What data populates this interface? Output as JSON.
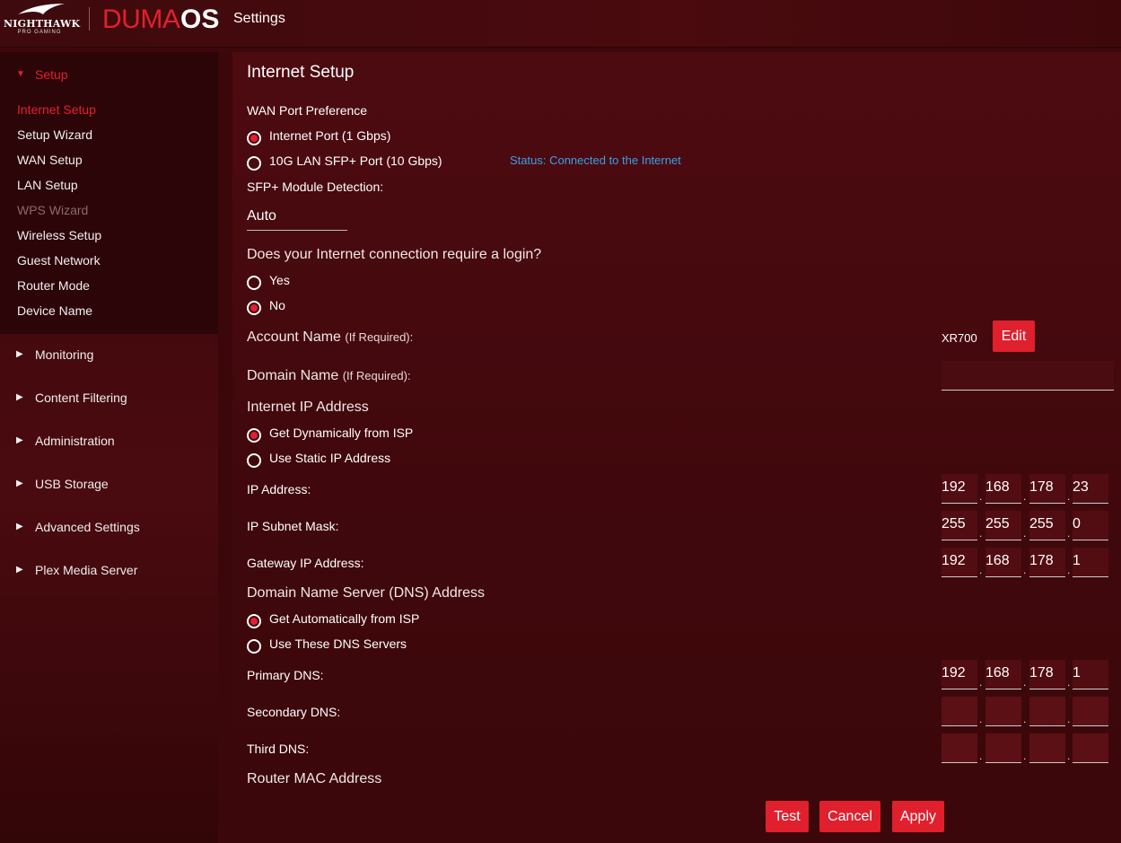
{
  "header": {
    "brand": "NIGHTHAWK",
    "brand_sub": "PRO GAMING",
    "product_a": "DUMA",
    "product_b": "OS",
    "title": "Settings"
  },
  "sidebar": {
    "setup": {
      "label": "Setup",
      "items": [
        "Internet Setup",
        "Setup Wizard",
        "WAN Setup",
        "LAN Setup",
        "WPS Wizard",
        "Wireless Setup",
        "Guest Network",
        "Router Mode",
        "Device Name"
      ]
    },
    "sections": [
      "Monitoring",
      "Content Filtering",
      "Administration",
      "USB Storage",
      "Advanced Settings",
      "Plex Media Server"
    ]
  },
  "main": {
    "title": "Internet Setup",
    "wan": {
      "label": "WAN Port Preference",
      "opt1": "Internet Port (1 Gbps)",
      "opt2": "10G LAN SFP+ Port (10 Gbps)",
      "selected": "Internet Port (1 Gbps)",
      "status": "Status: Connected to the Internet"
    },
    "sfp": {
      "label": "SFP+ Module Detection:",
      "value": "Auto"
    },
    "login": {
      "question": "Does your Internet connection require a login?",
      "yes": "Yes",
      "no": "No",
      "selected": "No"
    },
    "account": {
      "label": "Account Name",
      "hint": "(If Required):",
      "value": "XR700",
      "edit": "Edit"
    },
    "domain": {
      "label": "Domain Name",
      "hint": "(If Required):",
      "value": ""
    },
    "ip": {
      "heading": "Internet IP Address",
      "opt1": "Get Dynamically from ISP",
      "opt2": "Use Static IP Address",
      "selected": "Get Dynamically from ISP",
      "address_label": "IP Address:",
      "address": [
        "192",
        "168",
        "178",
        "23"
      ],
      "mask_label": "IP Subnet Mask:",
      "mask": [
        "255",
        "255",
        "255",
        "0"
      ],
      "gateway_label": "Gateway IP Address:",
      "gateway": [
        "192",
        "168",
        "178",
        "1"
      ]
    },
    "dns": {
      "heading": "Domain Name Server (DNS) Address",
      "opt1": "Get Automatically from ISP",
      "opt2": "Use These DNS Servers",
      "selected": "Get Automatically from ISP",
      "primary_label": "Primary DNS:",
      "primary": [
        "192",
        "168",
        "178",
        "1"
      ],
      "secondary_label": "Secondary DNS:",
      "secondary": [
        "",
        "",
        "",
        ""
      ],
      "third_label": "Third DNS:",
      "third": [
        "",
        "",
        "",
        ""
      ]
    },
    "mac": {
      "label": "Router MAC Address"
    },
    "buttons": {
      "test": "Test",
      "cancel": "Cancel",
      "apply": "Apply"
    }
  },
  "colors": {
    "accent": "#e2202f",
    "status": "#3d9ee8",
    "background": "#3d070b"
  }
}
